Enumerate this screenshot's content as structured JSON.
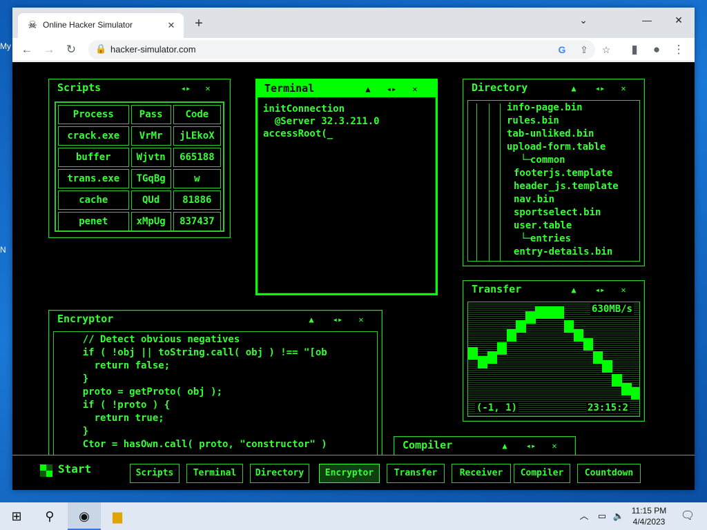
{
  "desktop": {
    "labels": [
      "My",
      "N"
    ]
  },
  "browser": {
    "tab_title": "Online Hacker Simulator",
    "tab_icon": "skull-icon",
    "url": "hacker-simulator.com"
  },
  "panels": {
    "scripts": {
      "title": "Scripts",
      "headers": [
        "Process",
        "Pass",
        "Code"
      ],
      "rows": [
        [
          "crack.exe",
          "VrMr",
          "jLEkoX"
        ],
        [
          "buffer",
          "Wjvtn",
          "665188"
        ],
        [
          "trans.exe",
          "TGqBg",
          "w"
        ],
        [
          "cache",
          "QUd",
          "81886"
        ],
        [
          "penet",
          "xMpUg",
          "837437"
        ]
      ]
    },
    "terminal": {
      "title": "Terminal",
      "lines": [
        "initConnection",
        "  @Server 32.3.211.0",
        "accessRoot(_"
      ]
    },
    "directory": {
      "title": "Directory",
      "items": [
        "info-page.bin",
        "rules.bin",
        "tab-unliked.bin",
        "upload-form.table",
        "common",
        "footerjs.template",
        "header_js.template",
        "nav.bin",
        "sportselect.bin",
        "user.table",
        "entries",
        "entry-details.bin"
      ]
    },
    "transfer": {
      "title": "Transfer",
      "speed": "630MB/s",
      "coords": "(-1, 1)",
      "time": "23:15:2",
      "levels": [
        0.55,
        0.45,
        0.5,
        0.6,
        0.75,
        0.85,
        0.95,
        1.0,
        1.0,
        1.0,
        0.85,
        0.75,
        0.65,
        0.5,
        0.4,
        0.25,
        0.15,
        0.1
      ]
    },
    "encryptor": {
      "title": "Encryptor",
      "lines": [
        "    // Detect obvious negatives",
        "    if ( !obj || toString.call( obj ) !== \"[ob",
        "      return false;",
        "    }",
        "    proto = getProto( obj );",
        "    if ( !proto ) {",
        "      return true;",
        "    }",
        "    Ctor = hasOwn.call( proto, \"constructor\" )"
      ]
    },
    "compiler": {
      "title": "Compiler"
    }
  },
  "taskbar": {
    "start": "Start",
    "buttons": [
      "Scripts",
      "Terminal",
      "Directory",
      "Encryptor",
      "Transfer",
      "Receiver",
      "Compiler",
      "Countdown"
    ]
  },
  "clock": {
    "time": "11:15 PM",
    "date": "4/4/2023"
  }
}
